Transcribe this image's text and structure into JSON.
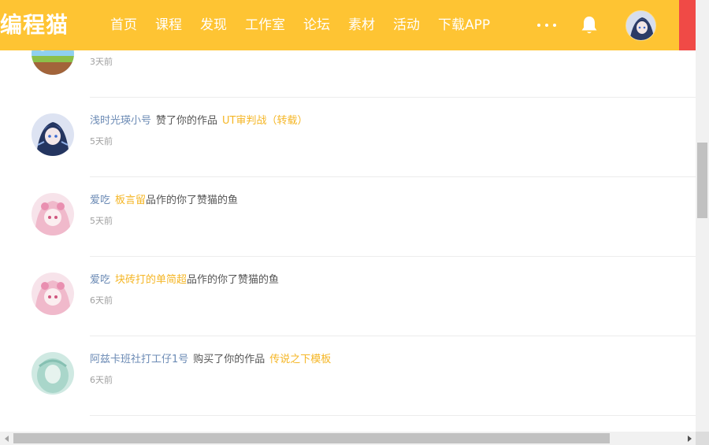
{
  "header": {
    "logo_text": "编程猫",
    "nav": [
      "首页",
      "课程",
      "发现",
      "工作室",
      "论坛",
      "素材",
      "活动",
      "下载APP"
    ],
    "more_icon": "more-dots-icon",
    "bell_icon": "bell-icon",
    "colors": {
      "bar": "#fec433",
      "edge": "#f04a46"
    }
  },
  "notifications": [
    {
      "user": "",
      "action": "",
      "work": "",
      "suffix": "",
      "time": "3天前"
    },
    {
      "user": "浅时光瑛小号",
      "action": "赞了你的作品",
      "work": "UT审判战（转载）",
      "suffix": "",
      "time": "5天前"
    },
    {
      "user": "爱吃",
      "action": "",
      "work": "板言留",
      "suffix": "品作的你了赞猫的鱼",
      "time": "5天前"
    },
    {
      "user": "爱吃",
      "action": "",
      "work": "块砖打的单简超",
      "suffix": "品作的你了赞猫的鱼",
      "time": "6天前"
    },
    {
      "user": "阿兹卡班社打工仔1号",
      "action": "购买了你的作品",
      "work": "传说之下模板",
      "suffix": "",
      "time": "6天前"
    }
  ],
  "colors": {
    "user_link": "#6c8bb5",
    "work_link": "#f5b625",
    "time": "#a0a0a0"
  }
}
